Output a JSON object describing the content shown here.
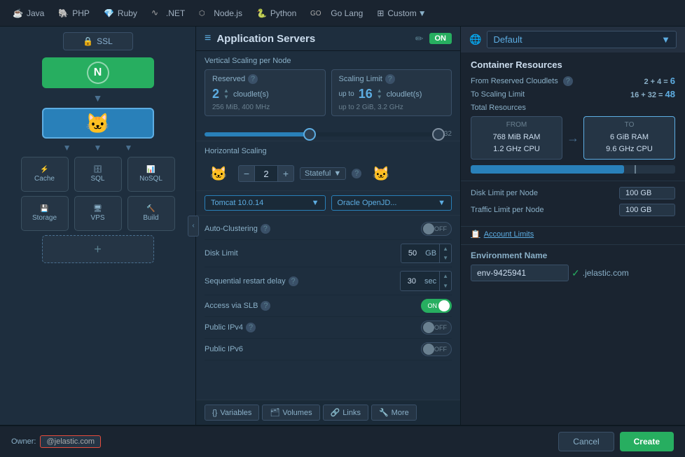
{
  "topnav": {
    "items": [
      {
        "label": "Java",
        "icon": "☕"
      },
      {
        "label": "PHP",
        "icon": "🐘"
      },
      {
        "label": "Ruby",
        "icon": "💎"
      },
      {
        "label": ".NET",
        "icon": "∿"
      },
      {
        "label": "Node.js",
        "icon": "⬡"
      },
      {
        "label": "Python",
        "icon": "🐍"
      },
      {
        "label": "Go Lang",
        "icon": "►"
      },
      {
        "label": "Custom",
        "icon": "⊞"
      }
    ]
  },
  "leftpanel": {
    "ssl_label": "SSL",
    "nodes": [
      {
        "name": "nginx",
        "label": "N"
      },
      {
        "name": "tomcat",
        "label": "🐱"
      }
    ],
    "subnodes": [
      {
        "label": "Cache"
      },
      {
        "label": "SQL"
      },
      {
        "label": "NoSQL"
      },
      {
        "label": "Storage"
      },
      {
        "label": "VPS"
      },
      {
        "label": "Build"
      }
    ]
  },
  "appserver": {
    "title": "Application Servers",
    "status": "ON",
    "vertical_scaling_label": "Vertical Scaling per Node",
    "reserved": {
      "label": "Reserved",
      "value": "2",
      "unit": "cloudlet(s)",
      "sub": "256 MiB, 400 MHz"
    },
    "scaling_limit": {
      "label": "Scaling Limit",
      "up_to": "up to",
      "value": "16",
      "unit": "cloudlet(s)",
      "sub": "up to 2 GiB, 3.2 GHz"
    },
    "slider_max": "32",
    "horizontal_scaling": {
      "label": "Horizontal Scaling",
      "count": "2",
      "type": "Stateful"
    },
    "versions": {
      "tomcat": "Tomcat 10.0.14",
      "jdk": "Oracle OpenJD..."
    },
    "settings": [
      {
        "label": "Auto-Clustering",
        "type": "toggle",
        "value": "OFF"
      },
      {
        "label": "Disk Limit",
        "type": "disk",
        "value": "50",
        "unit": "GB"
      },
      {
        "label": "Sequential restart delay",
        "type": "sec",
        "value": "30",
        "unit": "sec"
      },
      {
        "label": "Access via SLB",
        "type": "toggle",
        "value": "ON"
      },
      {
        "label": "Public IPv4",
        "type": "toggle",
        "value": "OFF"
      },
      {
        "label": "Public IPv6",
        "type": "toggle",
        "value": "OFF"
      }
    ],
    "tabs": [
      {
        "label": "Variables",
        "icon": "{} "
      },
      {
        "label": "Volumes",
        "icon": "🗂 "
      },
      {
        "label": "Links",
        "icon": "🔗 "
      },
      {
        "label": "More",
        "icon": "🔧 "
      }
    ]
  },
  "rightpanel": {
    "default_label": "Default",
    "container_resources": {
      "title": "Container Resources",
      "from_label": "From Reserved Cloudlets",
      "from_value": "2 + 4 = 6",
      "to_label": "To Scaling Limit",
      "to_value": "16 + 32 = 48",
      "total_label": "Total Resources",
      "from_box": {
        "label": "FROM",
        "ram": "768 MiB RAM",
        "cpu": "1.2 GHz CPU"
      },
      "to_box": {
        "label": "TO",
        "ram": "6 GiB RAM",
        "cpu": "9.6 GHz CPU"
      },
      "bar_percent": 75
    },
    "disk_limit_label": "Disk Limit per Node",
    "disk_limit_value": "100 GB",
    "traffic_limit_label": "Traffic Limit per Node",
    "traffic_limit_value": "100 GB",
    "account_limits_label": "Account Limits",
    "env_name": {
      "title": "Environment Name",
      "value": "env-9425941",
      "domain": ".jelastic.com"
    }
  },
  "footer": {
    "owner_label": "Owner:",
    "owner_email": "           @jelastic.com",
    "cancel_label": "Cancel",
    "create_label": "Create"
  }
}
